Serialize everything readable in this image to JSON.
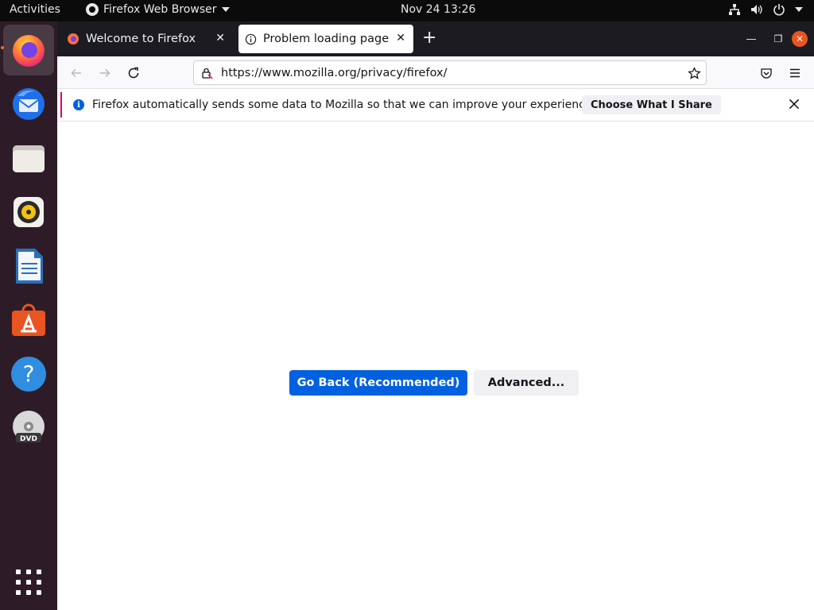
{
  "topbar": {
    "activities": "Activities",
    "app_name": "Firefox Web Browser",
    "clock": "Nov 24  13:26",
    "icons": [
      "network-icon",
      "volume-icon",
      "power-icon",
      "chevron-down-icon"
    ]
  },
  "dock": {
    "items": [
      "firefox",
      "thunderbird",
      "files",
      "rhythmbox",
      "libreoffice-writer",
      "ubuntu-software",
      "help",
      "dvd",
      "show-applications"
    ],
    "accent": "#e95420"
  },
  "browser": {
    "tabs": [
      {
        "label": "Welcome to Firefox",
        "active": false
      },
      {
        "label": "Problem loading page",
        "active": true
      }
    ],
    "url": "https://www.mozilla.org/privacy/firefox/",
    "notification": {
      "message": "Firefox automatically sends some data to Mozilla so that we can improve your experience.",
      "button": "Choose What I Share"
    },
    "buttons": {
      "go_back": "Go Back (Recommended)",
      "advanced": "Advanced..."
    },
    "colors": {
      "primary_button": "#0061e0",
      "notification_accent": "#e0005a"
    }
  }
}
